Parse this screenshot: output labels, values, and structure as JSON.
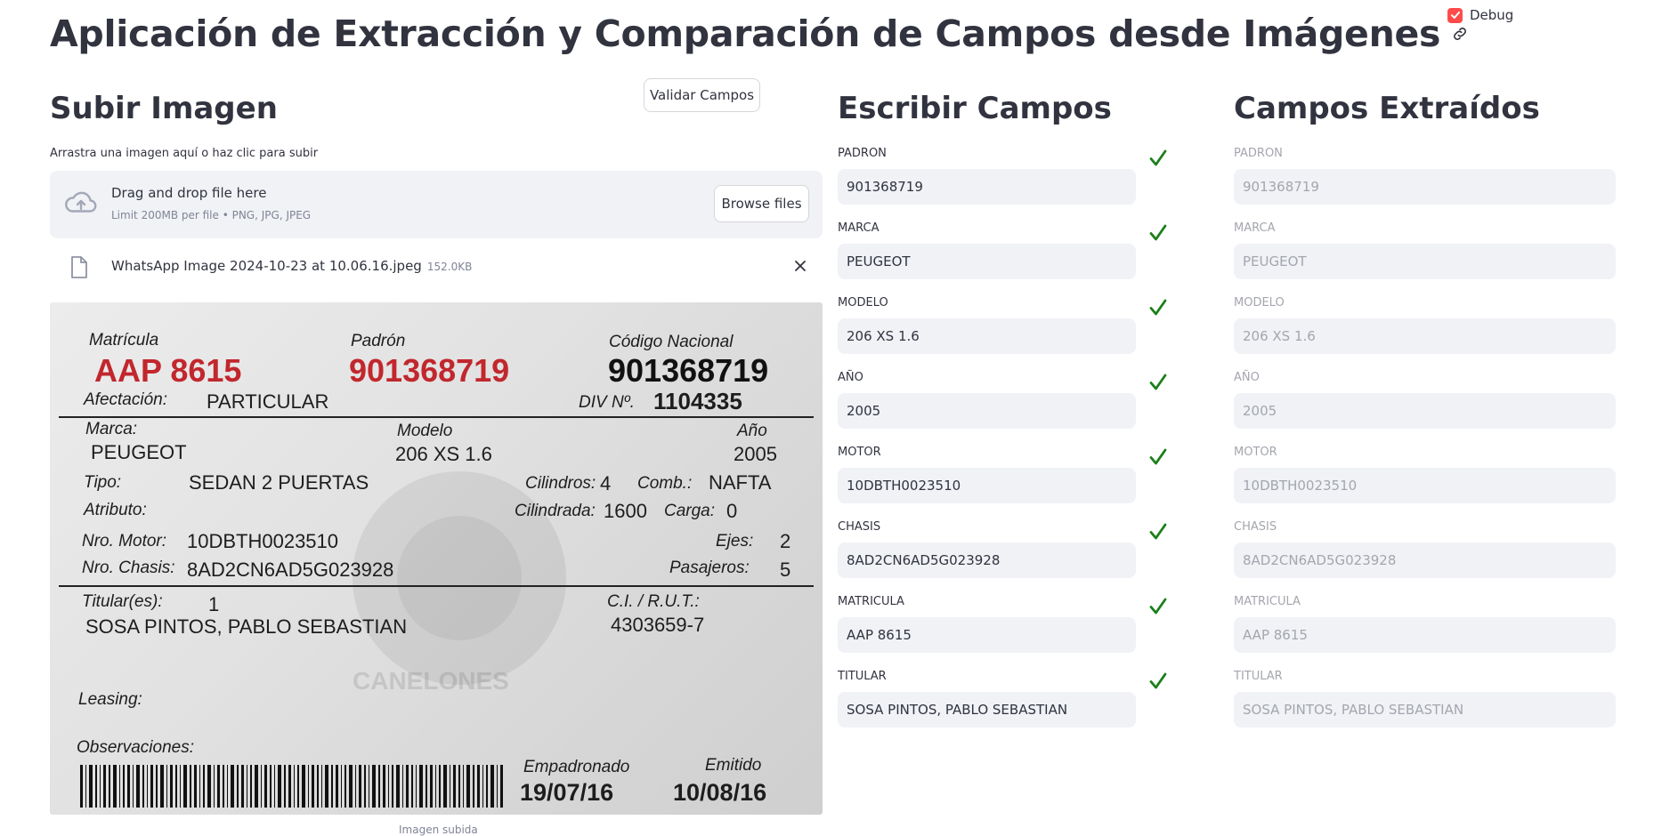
{
  "app": {
    "title": "Aplicación de Extracción y Comparación de Campos desde Imágenes",
    "debug_label": "Debug",
    "debug_checked": true,
    "validate_button": "Validar Campos"
  },
  "upload": {
    "heading": "Subir Imagen",
    "label": "Arrastra una imagen aquí o haz clic para subir",
    "drop_text": "Drag and drop file here",
    "limit_text": "Limit 200MB per file • PNG, JPG, JPEG",
    "browse_button": "Browse files",
    "file_name": "WhatsApp Image 2024-10-23 at 10.06.16.jpeg",
    "file_size": "152.0KB",
    "caption": "Imagen subida"
  },
  "document": {
    "matricula_label": "Matrícula",
    "matricula": "AAP 8615",
    "padron_label": "Padrón",
    "padron": "901368719",
    "codigo_label": "Código Nacional",
    "codigo": "901368719",
    "afectacion_label": "Afectación:",
    "afectacion": "PARTICULAR",
    "div_label": "DIV Nº.",
    "div": "1104335",
    "marca_label": "Marca:",
    "marca": "PEUGEOT",
    "modelo_label": "Modelo",
    "modelo": "206 XS 1.6",
    "anio_label": "Año",
    "anio": "2005",
    "tipo_label": "Tipo:",
    "tipo": "SEDAN 2 PUERTAS",
    "cilindros_label": "Cilindros:",
    "cilindros": "4",
    "comb_label": "Comb.:",
    "comb": "NAFTA",
    "atributo_label": "Atributo:",
    "cilindrada_label": "Cilindrada:",
    "cilindrada": "1600",
    "carga_label": "Carga:",
    "carga": "0",
    "motor_label": "Nro. Motor:",
    "motor": "10DBTH0023510",
    "ejes_label": "Ejes:",
    "ejes": "2",
    "chasis_label": "Nro. Chasis:",
    "chasis": "8AD2CN6AD5G023928",
    "pasajeros_label": "Pasajeros:",
    "pasajeros": "5",
    "titular_label": "Titular(es):",
    "titular_count": "1",
    "ci_label": "C.I. / R.U.T.:",
    "titular": "SOSA PINTOS, PABLO SEBASTIAN",
    "ci": "4303659-7",
    "watermark": "CANELONES",
    "leasing_label": "Leasing:",
    "observaciones_label": "Observaciones:",
    "empadronado_label": "Empadronado",
    "empadronado": "19/07/16",
    "emitido_label": "Emitido",
    "emitido": "10/08/16"
  },
  "write_fields": {
    "heading": "Escribir Campos",
    "items": [
      {
        "label": "PADRON",
        "value": "901368719",
        "valid": true
      },
      {
        "label": "MARCA",
        "value": "PEUGEOT",
        "valid": true
      },
      {
        "label": "MODELO",
        "value": "206 XS 1.6",
        "valid": true
      },
      {
        "label": "AÑO",
        "value": "2005",
        "valid": true
      },
      {
        "label": "MOTOR",
        "value": "10DBTH0023510",
        "valid": true
      },
      {
        "label": "CHASIS",
        "value": "8AD2CN6AD5G023928",
        "valid": true
      },
      {
        "label": "MATRICULA",
        "value": "AAP 8615",
        "valid": true
      },
      {
        "label": "TITULAR",
        "value": "SOSA PINTOS, PABLO SEBASTIAN",
        "valid": true
      }
    ]
  },
  "extracted_fields": {
    "heading": "Campos Extraídos",
    "items": [
      {
        "label": "PADRON",
        "value": "901368719"
      },
      {
        "label": "MARCA",
        "value": "PEUGEOT"
      },
      {
        "label": "MODELO",
        "value": "206 XS 1.6"
      },
      {
        "label": "AÑO",
        "value": "2005"
      },
      {
        "label": "MOTOR",
        "value": "10DBTH0023510"
      },
      {
        "label": "CHASIS",
        "value": "8AD2CN6AD5G023928"
      },
      {
        "label": "MATRICULA",
        "value": "AAP 8615"
      },
      {
        "label": "TITULAR",
        "value": "SOSA PINTOS, PABLO SEBASTIAN"
      }
    ]
  },
  "colors": {
    "accent": "#ff4b4b",
    "check": "#1a7f1a",
    "input_bg": "#f0f2f6",
    "text": "#31333f",
    "red_print": "#c1272d"
  },
  "icons": {
    "debug": "checkbox-checked-icon",
    "title_anchor": "link-icon",
    "upload": "cloud-upload-icon",
    "file": "file-icon",
    "remove": "close-icon",
    "valid": "checkmark-icon"
  }
}
